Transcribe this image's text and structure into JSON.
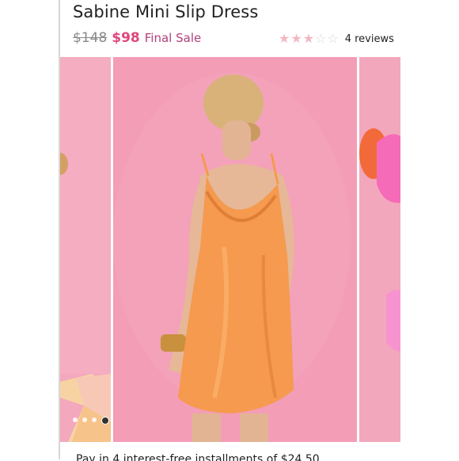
{
  "product": {
    "title": "Sabine Mini Slip Dress",
    "old_price": "$148",
    "new_price": "$98",
    "sale_label": "Final Sale",
    "rating": 3,
    "rating_max": 5,
    "reviews_label": "4 reviews"
  },
  "gallery": {
    "dot_count": 5,
    "active_index": 3,
    "images": [
      {
        "name": "left-product-image"
      },
      {
        "name": "main-product-image"
      },
      {
        "name": "right-product-image"
      }
    ]
  },
  "colors": {
    "sale_price": "#e0457b",
    "final_sale": "#b0417a",
    "star_filled": "#f3b7c2",
    "star_empty": "#d7d7d7",
    "background_pink": "#f39db7",
    "dress_orange": "#f59a4e"
  },
  "bottom": {
    "text": "Pay in 4 interest-free installments of $24.50"
  }
}
